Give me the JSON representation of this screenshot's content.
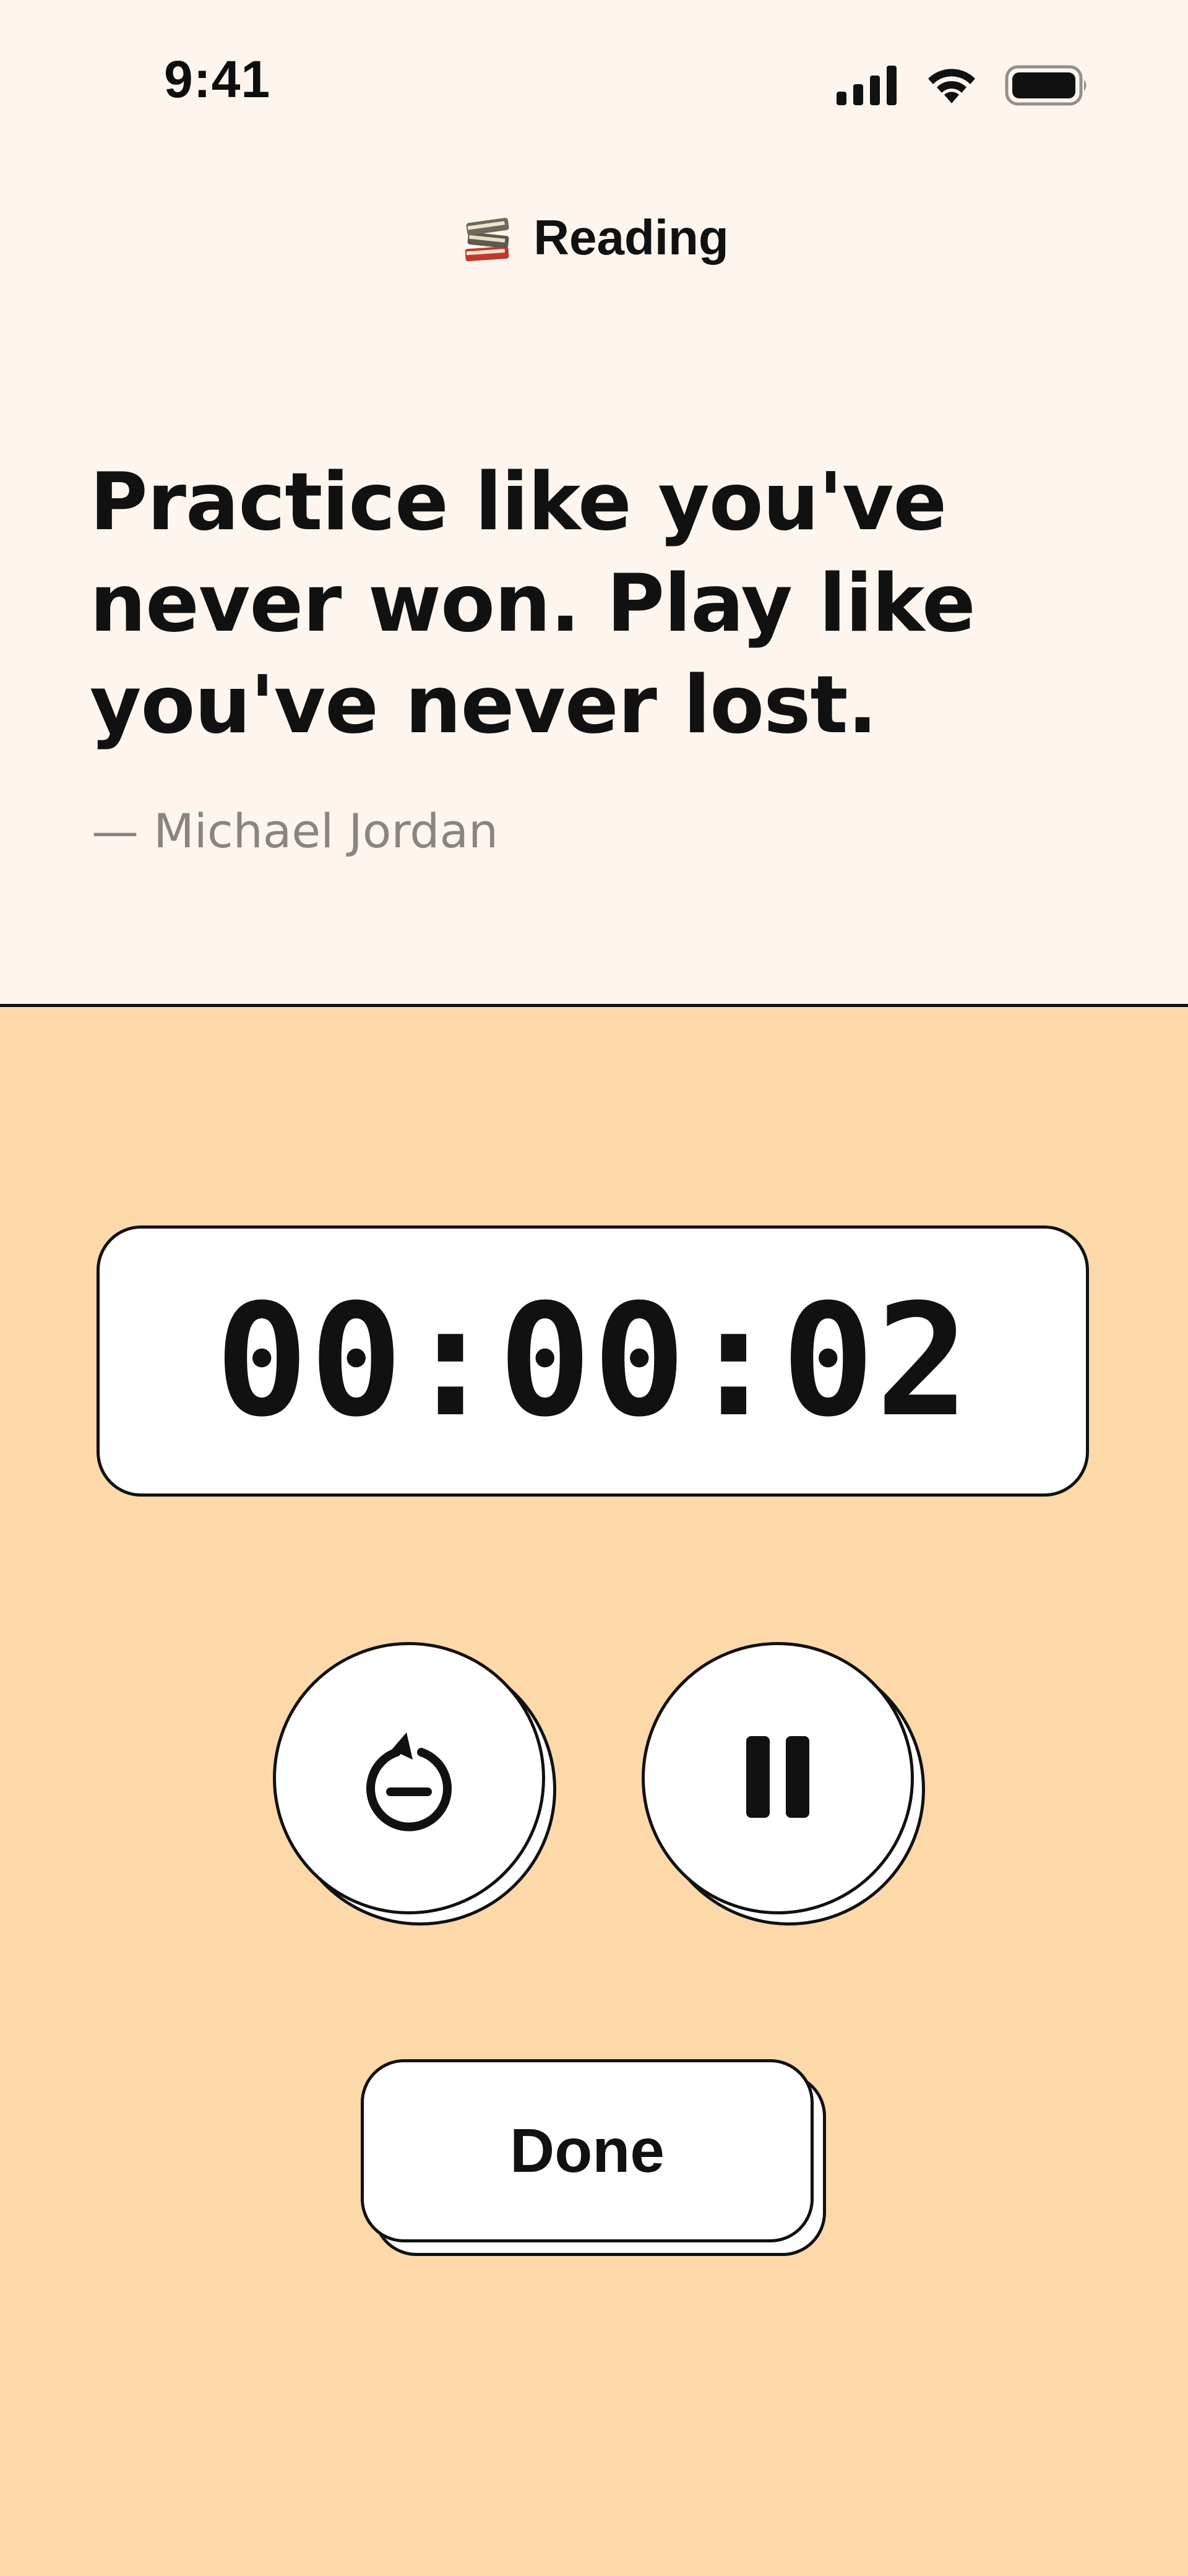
{
  "status_bar": {
    "time": "9:41",
    "icons": [
      "cellular-signal-icon",
      "wifi-icon",
      "battery-icon"
    ]
  },
  "header": {
    "icon": "books-icon",
    "title": "Reading"
  },
  "quote": {
    "text": "Practice like you've never won. Play like you've never lost.",
    "author": "— Michael Jordan"
  },
  "timer": {
    "value": "00:00:02"
  },
  "controls": {
    "reset_icon": "timer-reset-icon",
    "pause_icon": "pause-icon"
  },
  "done_button": {
    "label": "Done"
  },
  "colors": {
    "top_background": "#FEF6EE",
    "bottom_background": "#FDD9AA",
    "text_primary": "#111111",
    "text_secondary": "#8A8582",
    "card_background": "#FFFFFF"
  }
}
